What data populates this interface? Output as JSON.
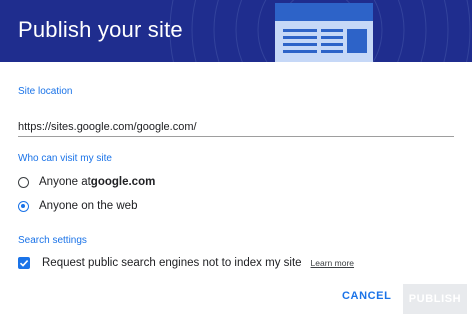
{
  "header": {
    "title": "Publish your site"
  },
  "site_location": {
    "label": "Site location",
    "value": "https://sites.google.com/google.com/"
  },
  "visibility": {
    "label": "Who can visit my site",
    "option_domain_prefix": "Anyone at ",
    "option_domain_name": "google.com",
    "option_web": "Anyone on the web",
    "selected": "web"
  },
  "search": {
    "label": "Search settings",
    "checkbox_label": "Request public search engines not to index my site",
    "checked": true,
    "learn_more": "Learn more"
  },
  "actions": {
    "cancel": "CANCEL",
    "publish": "PUBLISH"
  },
  "colors": {
    "header_bg": "#1f2d8e",
    "accent": "#1a73e8",
    "disabled_button": "#e8eaed"
  }
}
